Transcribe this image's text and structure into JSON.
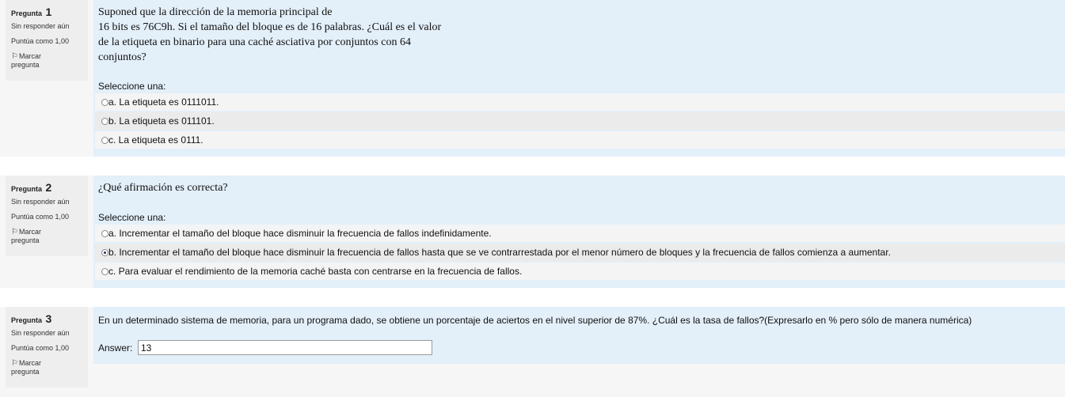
{
  "questions": [
    {
      "label": "Pregunta",
      "number": "1",
      "state": "Sin responder aún",
      "grade": "Puntúa como 1,00",
      "flag_label": "Marcar",
      "flag_label2": "pregunta",
      "text_lines": [
        "Suponed que la dirección de la memoria principal de",
        "16 bits es 76C9h. Si el tamaño del bloque es de 16 palabras. ¿Cuál es el valor",
        "de la etiqueta en binario para una caché asciativa por conjuntos con 64",
        "conjuntos?"
      ],
      "prompt": "Seleccione una:",
      "options": [
        {
          "text": "a. La etiqueta es 0111011.",
          "checked": false
        },
        {
          "text": "b. La etiqueta es 011101.",
          "checked": false
        },
        {
          "text": "c. La etiqueta es 0111.",
          "checked": false
        }
      ]
    },
    {
      "label": "Pregunta",
      "number": "2",
      "state": "Sin responder aún",
      "grade": "Puntúa como 1,00",
      "flag_label": "Marcar",
      "flag_label2": "pregunta",
      "text_lines": [
        "¿Qué afirmación es correcta?"
      ],
      "prompt": "Seleccione una:",
      "options": [
        {
          "text": "a. Incrementar el tamaño del bloque hace disminuir la frecuencia de fallos indefinidamente.",
          "checked": false
        },
        {
          "text": "b. Incrementar el tamaño del bloque hace disminuir la frecuencia de fallos hasta que se ve contrarrestada por el menor número de bloques y la frecuencia de fallos comienza a aumentar.",
          "checked": true
        },
        {
          "text": "c. Para evaluar el rendimiento de la memoria caché basta con centrarse en la frecuencia de fallos.",
          "checked": false
        }
      ]
    },
    {
      "label": "Pregunta",
      "number": "3",
      "state": "Sin responder aún",
      "grade": "Puntúa como 1,00",
      "flag_label": "Marcar",
      "flag_label2": "pregunta",
      "text_lines": [
        "En un determinado sistema de memoria, para un programa dado, se obtiene un porcentaje de aciertos en el nivel superior de 87%. ¿Cuál es la tasa de fallos?(Expresarlo en % pero sólo de manera numérica)"
      ],
      "answer_label": "Answer:",
      "answer_value": "13"
    }
  ]
}
